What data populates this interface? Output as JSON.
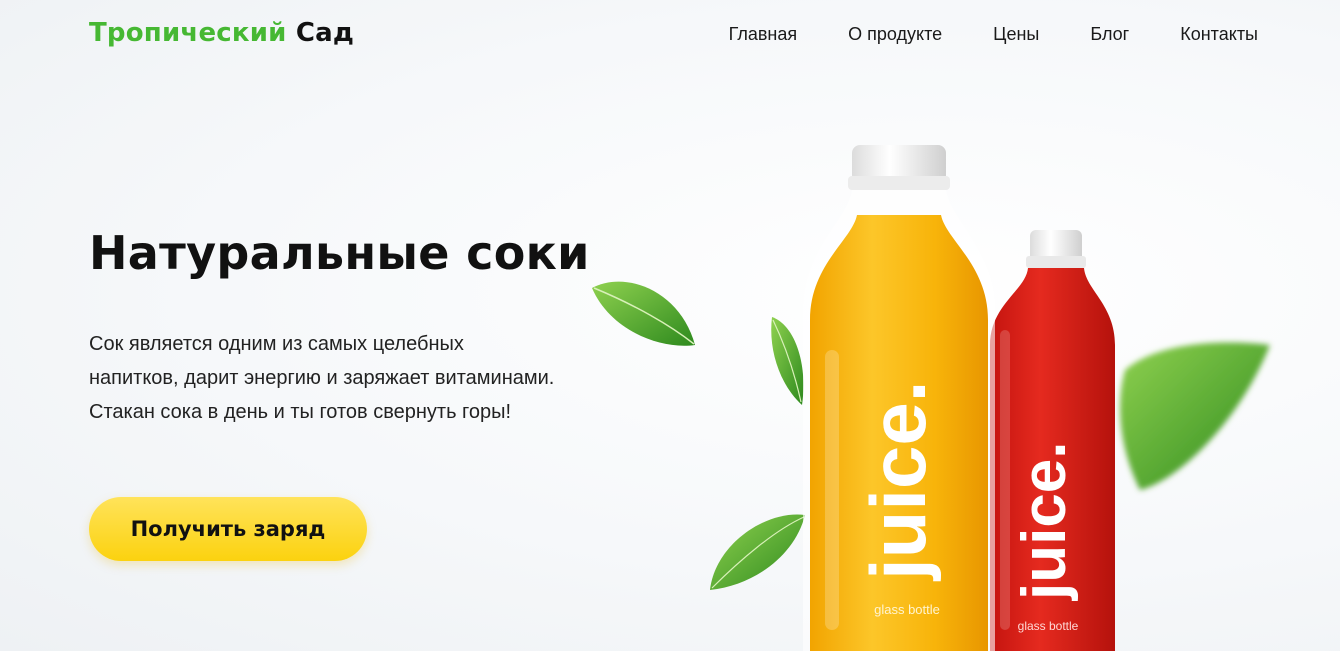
{
  "brand": {
    "part1": "Тропический",
    "part2": "Сад",
    "accent_color": "#46b833"
  },
  "nav": {
    "items": [
      {
        "label": "Главная"
      },
      {
        "label": "О продукте"
      },
      {
        "label": "Цены"
      },
      {
        "label": "Блог"
      },
      {
        "label": "Контакты"
      }
    ]
  },
  "hero": {
    "title": "Натуральные соки",
    "description": "Сок является одним из самых целебных напитков, дарит энергию и заряжает витаминами. Стакан сока в день и ты готов свернуть горы!",
    "cta_label": "Получить заряд",
    "cta_color": "#fbd20f"
  },
  "bottles": [
    {
      "brand": "juice.",
      "caption": "glass bottle",
      "color": "#f7b500",
      "name": "orange-juice"
    },
    {
      "brand": "juice.",
      "caption": "glass bottle",
      "color": "#d6201a",
      "name": "red-juice"
    }
  ]
}
